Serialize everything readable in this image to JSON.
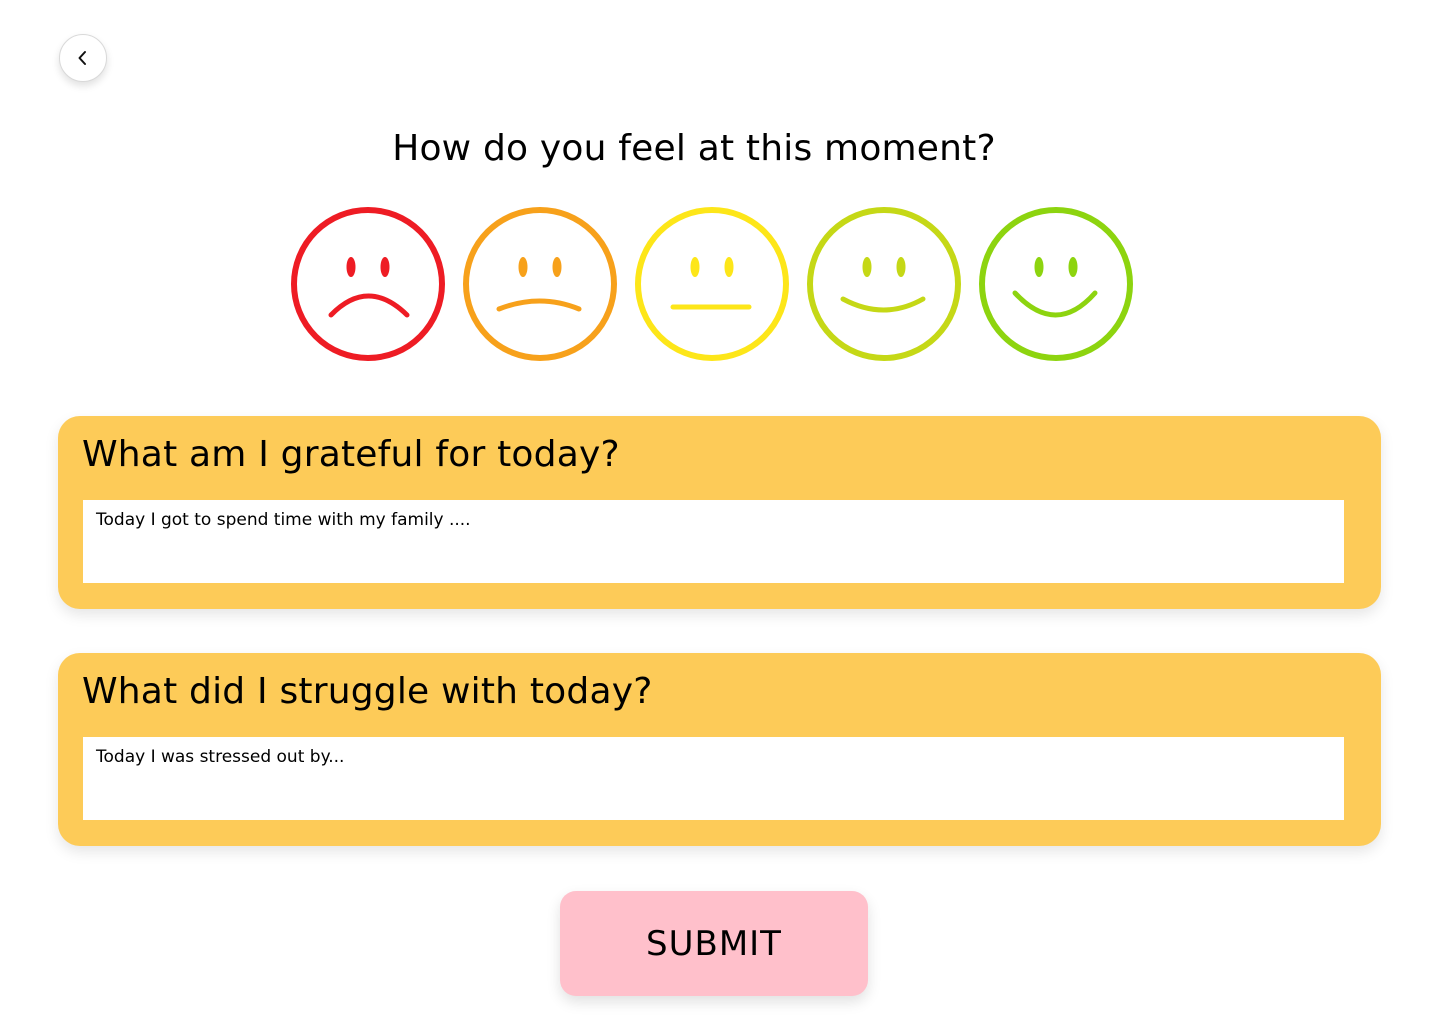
{
  "header": {
    "back_icon": "chevron-left-icon"
  },
  "mood_question": "How do you feel at this moment?",
  "mood_scale": [
    {
      "icon": "very-sad-face-icon",
      "color": "#ee1c24"
    },
    {
      "icon": "sad-face-icon",
      "color": "#f7a11b"
    },
    {
      "icon": "neutral-face-icon",
      "color": "#fde619"
    },
    {
      "icon": "happy-face-icon",
      "color": "#c5d816"
    },
    {
      "icon": "very-happy-face-icon",
      "color": "#8dd40f"
    }
  ],
  "grateful": {
    "title": "What am I grateful for today?",
    "placeholder": "Today I got to spend time with my family ...."
  },
  "struggle": {
    "title": "What did I struggle with today?",
    "placeholder": "Today I was stressed out by..."
  },
  "submit_label": "SUBMIT",
  "colors": {
    "card_background": "#fdcb58",
    "submit_background": "#ffc0cb"
  }
}
